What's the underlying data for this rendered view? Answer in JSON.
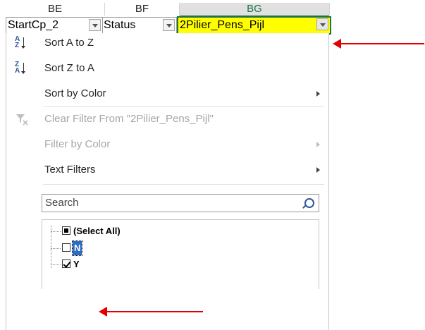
{
  "columns": [
    "BE",
    "BF",
    "BG"
  ],
  "header_cells": [
    {
      "text": "StartCp_2"
    },
    {
      "text": "Status"
    },
    {
      "text": "2Pilier_Pens_Pijl"
    }
  ],
  "menu": {
    "sort_az": "Sort A to Z",
    "sort_za": "Sort Z to A",
    "sort_by_color": "Sort by Color",
    "clear_filter": "Clear Filter From \"2Pilier_Pens_Pijl\"",
    "filter_by_color": "Filter by Color",
    "text_filters": "Text Filters"
  },
  "search": {
    "placeholder": "Search"
  },
  "list_items": [
    {
      "label": "(Select All)",
      "state": "partial"
    },
    {
      "label": "N",
      "state": "unchecked"
    },
    {
      "label": "Y",
      "state": "checked"
    }
  ],
  "colors": {
    "header_highlight": "#ffff00",
    "annotation_arrow": "#e00000",
    "excel_green": "#217346"
  },
  "icons": {
    "sort_az": "sort-ascending-icon",
    "sort_za": "sort-descending-icon",
    "clear_filter": "clear-filter-icon",
    "search": "search-icon"
  }
}
